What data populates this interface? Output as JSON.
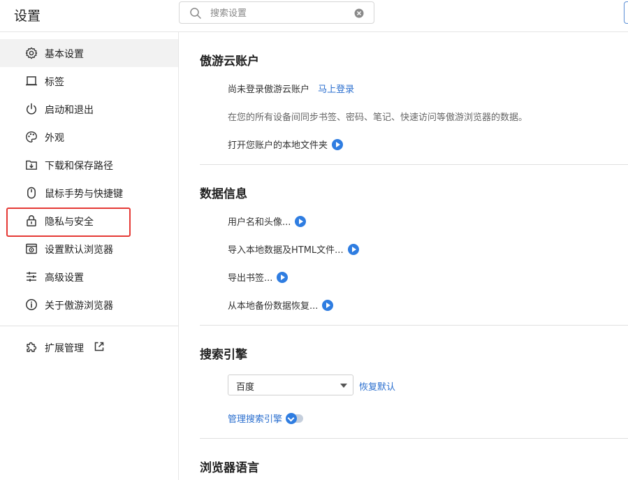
{
  "header": {
    "title": "设置",
    "search_placeholder": "搜索设置"
  },
  "sidebar": {
    "items": [
      {
        "label": "基本设置",
        "icon": "gear-icon",
        "active": true
      },
      {
        "label": "标签",
        "icon": "tab-icon"
      },
      {
        "label": "启动和退出",
        "icon": "power-icon"
      },
      {
        "label": "外观",
        "icon": "palette-icon"
      },
      {
        "label": "下载和保存路径",
        "icon": "download-folder-icon"
      },
      {
        "label": "鼠标手势与快捷键",
        "icon": "mouse-icon"
      },
      {
        "label": "隐私与安全",
        "icon": "lock-icon",
        "highlighted": true
      },
      {
        "label": "设置默认浏览器",
        "icon": "default-browser-icon"
      },
      {
        "label": "高级设置",
        "icon": "sliders-icon"
      },
      {
        "label": "关于傲游浏览器",
        "icon": "info-icon"
      }
    ],
    "extensions": {
      "label": "扩展管理",
      "icon": "puzzle-icon",
      "link_icon": "external-link-icon"
    }
  },
  "account": {
    "title": "傲游云账户",
    "status": "尚未登录傲游云账户",
    "login_link": "马上登录",
    "description": "在您的所有设备间同步书签、密码、笔记、快速访问等傲游浏览器的数据。",
    "open_folder": "打开您账户的本地文件夹"
  },
  "data_info": {
    "title": "数据信息",
    "items": [
      "用户名和头像...",
      "导入本地数据及HTML文件...",
      "导出书签...",
      "从本地备份数据恢复..."
    ]
  },
  "search_engine": {
    "title": "搜索引擎",
    "selected": "百度",
    "restore_default": "恢复默认",
    "manage": "管理搜索引擎"
  },
  "language": {
    "title": "浏览器语言"
  },
  "colors": {
    "accent": "#2f7de1",
    "link": "#2b6fcf",
    "highlight_border": "#e53935",
    "active_bg": "#f2f2f2"
  }
}
